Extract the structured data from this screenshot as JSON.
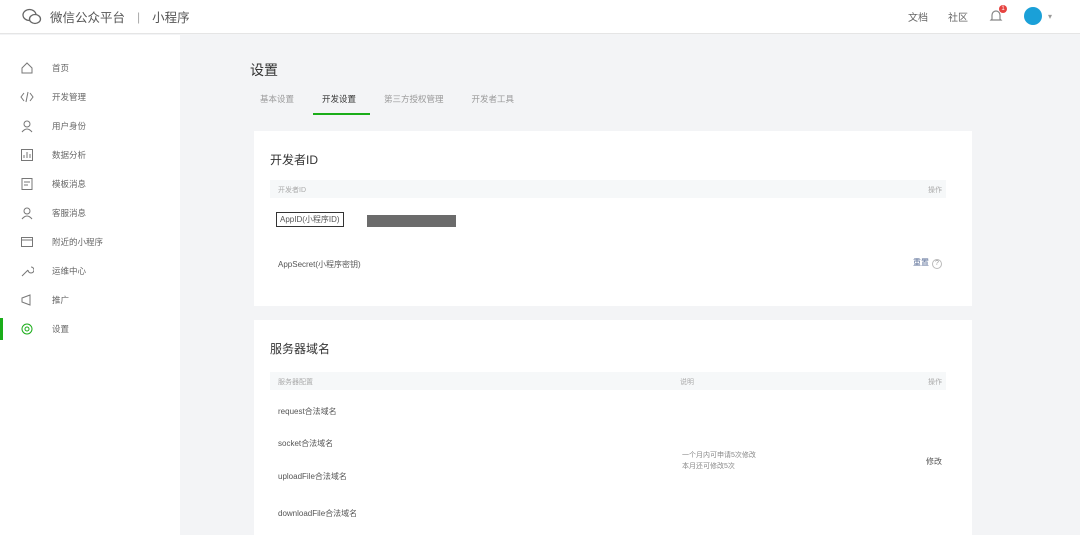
{
  "header": {
    "brand": "微信公众平台",
    "section": "小程序",
    "links": [
      "文档",
      "社区"
    ],
    "notification_count": "1"
  },
  "sidebar": {
    "items": [
      {
        "label": "首页",
        "icon": "home-icon"
      },
      {
        "label": "开发管理",
        "icon": "code-icon"
      },
      {
        "label": "用户身份",
        "icon": "user-icon"
      },
      {
        "label": "数据分析",
        "icon": "chart-icon"
      },
      {
        "label": "模板消息",
        "icon": "template-icon"
      },
      {
        "label": "客服消息",
        "icon": "service-icon"
      },
      {
        "label": "附近的小程序",
        "icon": "nearby-icon"
      },
      {
        "label": "运维中心",
        "icon": "wrench-icon"
      },
      {
        "label": "推广",
        "icon": "promote-icon"
      },
      {
        "label": "设置",
        "icon": "settings-icon",
        "active": true
      }
    ]
  },
  "main": {
    "title": "设置",
    "tabs": [
      {
        "label": "基本设置",
        "active": false
      },
      {
        "label": "开发设置",
        "active": true
      },
      {
        "label": "第三方授权管理",
        "active": false
      },
      {
        "label": "开发者工具",
        "active": false
      }
    ],
    "developer_id": {
      "title": "开发者ID",
      "columns": [
        "开发者ID",
        "操作"
      ],
      "rows": [
        {
          "label": "AppID(小程序ID)",
          "value": "",
          "action": ""
        },
        {
          "label": "AppSecret(小程序密钥)",
          "value": "",
          "action": "重置"
        }
      ]
    },
    "server_domain": {
      "title": "服务器域名",
      "columns": [
        "服务器配置",
        "说明",
        "操作"
      ],
      "rows": [
        "request合法域名",
        "socket合法域名",
        "uploadFile合法域名",
        "downloadFile合法域名"
      ],
      "note_line1": "一个月内可申请5次修改",
      "note_line2": "本月还可修改5次",
      "action": "修改"
    }
  },
  "colors": {
    "accent": "#1aad19",
    "link": "#576b95",
    "avatar": "#1aa0d8"
  }
}
